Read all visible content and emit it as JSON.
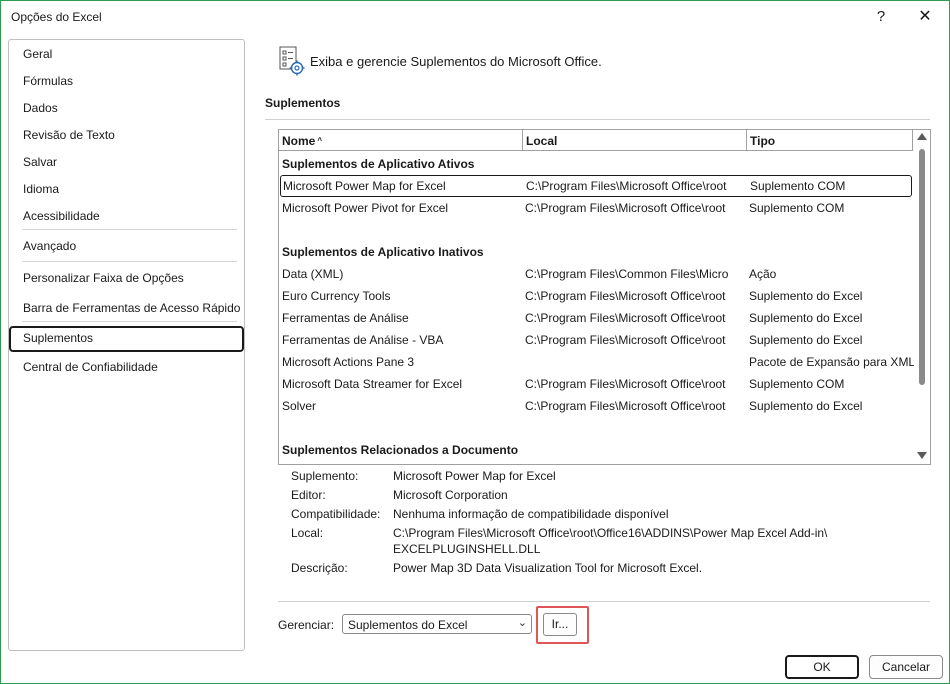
{
  "window": {
    "title": "Opções do Excel",
    "help_glyph": "?",
    "close_glyph": "✕"
  },
  "sidebar": {
    "items": [
      {
        "label": "Geral"
      },
      {
        "label": "Fórmulas"
      },
      {
        "label": "Dados"
      },
      {
        "label": "Revisão de Texto"
      },
      {
        "label": "Salvar"
      },
      {
        "label": "Idioma"
      },
      {
        "label": "Acessibilidade"
      },
      {
        "label": "Avançado"
      },
      {
        "label": "Personalizar Faixa de Opções"
      },
      {
        "label": "Barra de Ferramentas de Acesso Rápido"
      },
      {
        "label": "Suplementos",
        "active": true
      },
      {
        "label": "Central de Confiabilidade"
      }
    ]
  },
  "main": {
    "header": "Exiba e gerencie Suplementos do Microsoft Office.",
    "section_title": "Suplementos",
    "columns": {
      "name": "Nome",
      "sort_glyph": "^",
      "location": "Local",
      "type": "Tipo"
    },
    "groups": [
      {
        "title": "Suplementos de Aplicativo Ativos",
        "rows": [
          {
            "name": "Microsoft Power Map for Excel",
            "location": "C:\\Program Files\\Microsoft Office\\root",
            "type": "Suplemento COM",
            "selected": true
          },
          {
            "name": "Microsoft Power Pivot for Excel",
            "location": "C:\\Program Files\\Microsoft Office\\root",
            "type": "Suplemento COM"
          }
        ]
      },
      {
        "title": "Suplementos de Aplicativo Inativos",
        "rows": [
          {
            "name": "Data (XML)",
            "location": "C:\\Program Files\\Common Files\\Micro",
            "type": "Ação"
          },
          {
            "name": "Euro Currency Tools",
            "location": "C:\\Program Files\\Microsoft Office\\root",
            "type": "Suplemento do Excel"
          },
          {
            "name": "Ferramentas de Análise",
            "location": "C:\\Program Files\\Microsoft Office\\root",
            "type": "Suplemento do Excel"
          },
          {
            "name": "Ferramentas de Análise - VBA",
            "location": "C:\\Program Files\\Microsoft Office\\root",
            "type": "Suplemento do Excel"
          },
          {
            "name": "Microsoft Actions Pane 3",
            "location": "",
            "type": "Pacote de Expansão para XML"
          },
          {
            "name": "Microsoft Data Streamer for Excel",
            "location": "C:\\Program Files\\Microsoft Office\\root",
            "type": "Suplemento COM"
          },
          {
            "name": "Solver",
            "location": "C:\\Program Files\\Microsoft Office\\root",
            "type": "Suplemento do Excel"
          }
        ]
      },
      {
        "title": "Suplementos Relacionados a Documento",
        "rows": []
      }
    ],
    "details": {
      "addin_label": "Suplemento:",
      "addin_value": "Microsoft Power Map for Excel",
      "publisher_label": "Editor:",
      "publisher_value": "Microsoft Corporation",
      "compat_label": "Compatibilidade:",
      "compat_value": "Nenhuma informação de compatibilidade disponível",
      "location_label": "Local:",
      "location_value_1": "C:\\Program Files\\Microsoft Office\\root\\Office16\\ADDINS\\Power Map Excel Add-in\\",
      "location_value_2": "EXCELPLUGINSHELL.DLL",
      "description_label": "Descrição:",
      "description_value": "Power Map 3D Data Visualization Tool for Microsoft Excel."
    },
    "manage": {
      "label": "Gerenciar:",
      "selected": "Suplementos do Excel",
      "go_label": "Ir..."
    }
  },
  "footer": {
    "ok_label": "OK",
    "cancel_label": "Cancelar"
  },
  "colors": {
    "highlight": "#e05555",
    "window_border": "#2e9c4e"
  }
}
